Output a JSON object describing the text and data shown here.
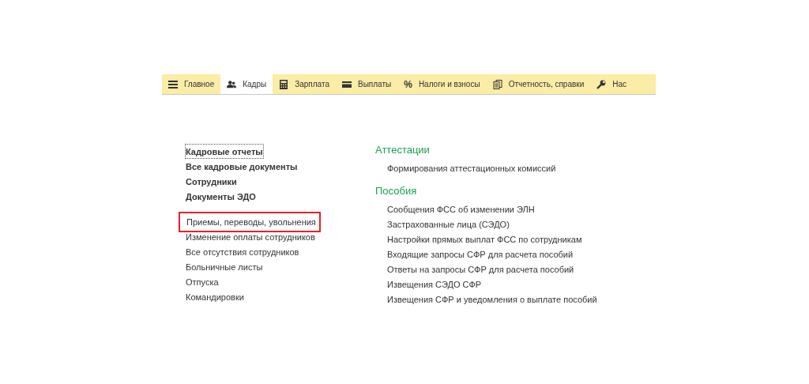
{
  "tabs": [
    {
      "label": "Главное",
      "kind": "menu",
      "selected": false
    },
    {
      "label": "Кадры",
      "kind": "people",
      "selected": true
    },
    {
      "label": "Зарплата",
      "kind": "calculator",
      "selected": false
    },
    {
      "label": "Выплаты",
      "kind": "card",
      "selected": false
    },
    {
      "label": "Налоги и взносы",
      "kind": "percent",
      "glyph": "%",
      "selected": false
    },
    {
      "label": "Отчетность, справки",
      "kind": "documents",
      "selected": false
    },
    {
      "label": "Нас",
      "kind": "wrench",
      "selected": false
    }
  ],
  "left_groups": [
    [
      {
        "label": "Кадровые отчеты",
        "bold": true,
        "focused": true,
        "highlighted": false
      },
      {
        "label": "Все кадровые документы",
        "bold": true,
        "focused": false,
        "highlighted": false
      },
      {
        "label": "Сотрудники",
        "bold": true,
        "focused": false,
        "highlighted": false
      },
      {
        "label": "Документы ЭДО",
        "bold": true,
        "focused": false,
        "highlighted": false
      }
    ],
    [
      {
        "label": "Приемы, переводы, увольнения",
        "bold": false,
        "focused": false,
        "highlighted": true
      },
      {
        "label": "Изменение оплаты сотрудников",
        "bold": false,
        "focused": false,
        "highlighted": false
      },
      {
        "label": "Все отсутствия сотрудников",
        "bold": false,
        "focused": false,
        "highlighted": false
      },
      {
        "label": "Больничные листы",
        "bold": false,
        "focused": false,
        "highlighted": false
      },
      {
        "label": "Отпуска",
        "bold": false,
        "focused": false,
        "highlighted": false
      },
      {
        "label": "Командировки",
        "bold": false,
        "focused": false,
        "highlighted": false
      }
    ]
  ],
  "sections": [
    {
      "title": "Аттестации",
      "items": [
        "Формирования аттестационных комиссий"
      ]
    },
    {
      "title": "Пособия",
      "items": [
        "Сообщения ФСС об изменении ЭЛН",
        "Застрахованные лица (СЭДО)",
        "Настройки прямых выплат ФСС по сотрудникам",
        "Входящие запросы СФР для расчета пособий",
        "Ответы на запросы СФР для расчета пособий",
        "Извещения СЭДО СФР",
        "Извещения СФР и уведомления о выплате пособий"
      ]
    }
  ]
}
